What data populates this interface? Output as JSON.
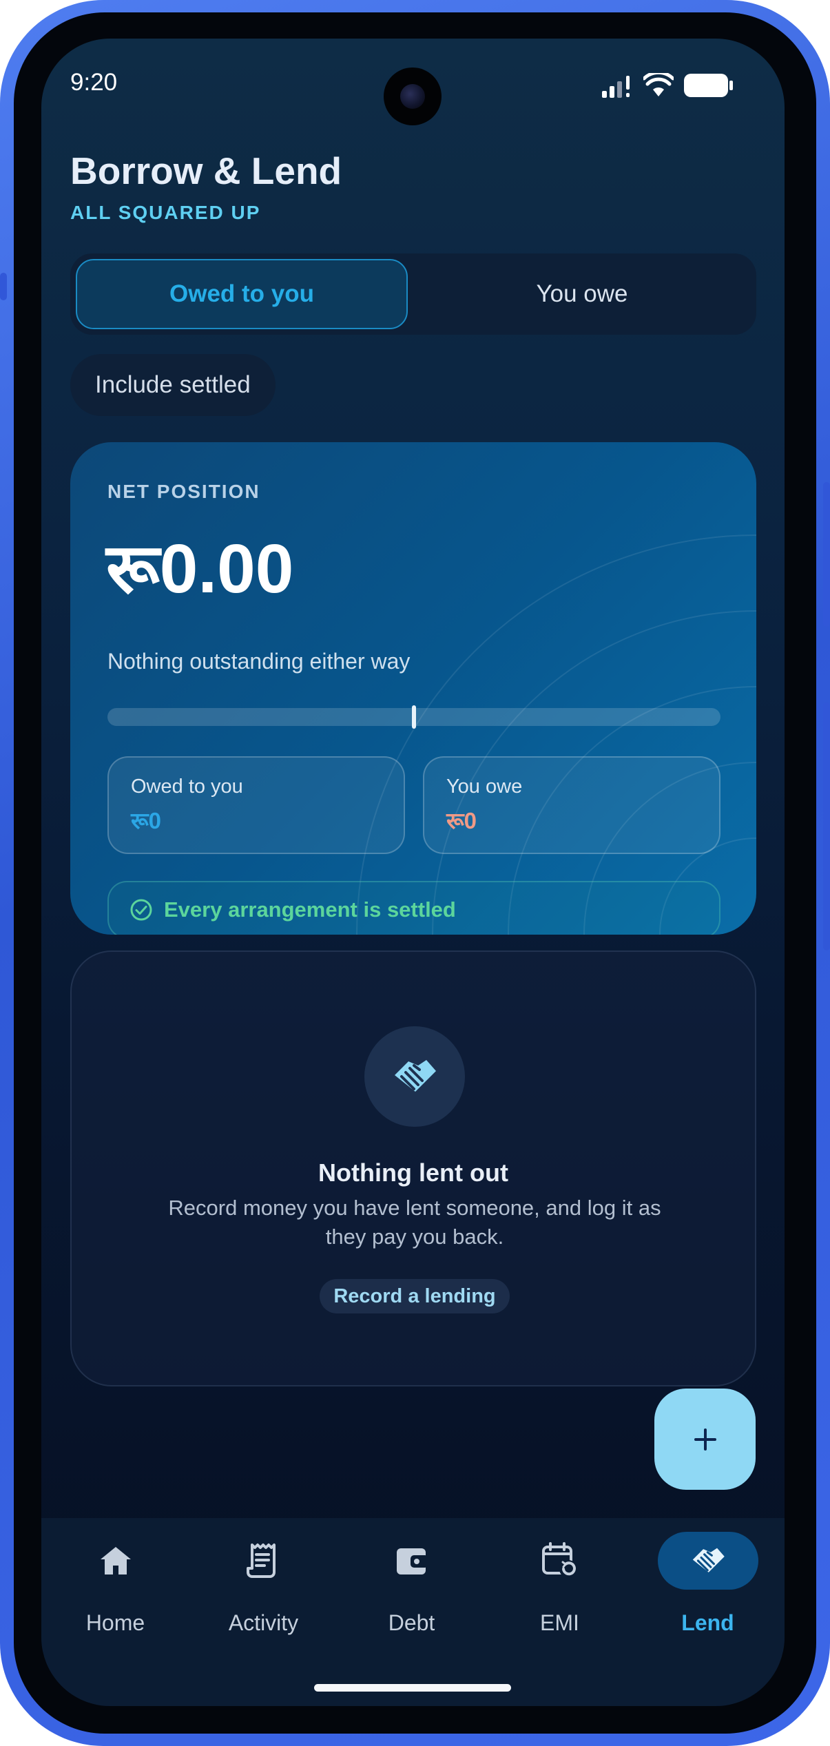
{
  "status_bar": {
    "time": "9:20"
  },
  "header": {
    "title": "Borrow & Lend",
    "subtitle": "ALL SQUARED UP"
  },
  "segment": {
    "active_label": "Owed to you",
    "inactive_label": "You owe"
  },
  "filter_chip": {
    "label": "Include settled"
  },
  "net_position": {
    "label": "NET POSITION",
    "amount": "रू0.00",
    "description": "Nothing outstanding either way",
    "balance_level": 0.5,
    "owed_to_you": {
      "label": "Owed to you",
      "value": "रू0",
      "color": "#2ba7e6"
    },
    "you_owe": {
      "label": "You owe",
      "value": "रू0",
      "color": "#f09a86"
    },
    "settled_message": "Every arrangement is settled"
  },
  "empty_state": {
    "icon": "handshake-icon",
    "title": "Nothing lent out",
    "description": "Record money you have lent someone, and log it as they pay you back.",
    "action_label": "Record a lending"
  },
  "fab": {
    "icon": "plus-icon"
  },
  "bottom_nav": {
    "items": [
      {
        "label": "Home",
        "icon": "home-icon",
        "active": false
      },
      {
        "label": "Activity",
        "icon": "receipt-icon",
        "active": false
      },
      {
        "label": "Debt",
        "icon": "wallet-icon",
        "active": false
      },
      {
        "label": "EMI",
        "icon": "calendar-repeat-icon",
        "active": false
      },
      {
        "label": "Lend",
        "icon": "handshake-icon",
        "active": true
      }
    ]
  },
  "colors": {
    "accent": "#26aee8",
    "positive": "#5cd59c",
    "fab": "#8fd8f4",
    "frame": "#3a63e0"
  }
}
